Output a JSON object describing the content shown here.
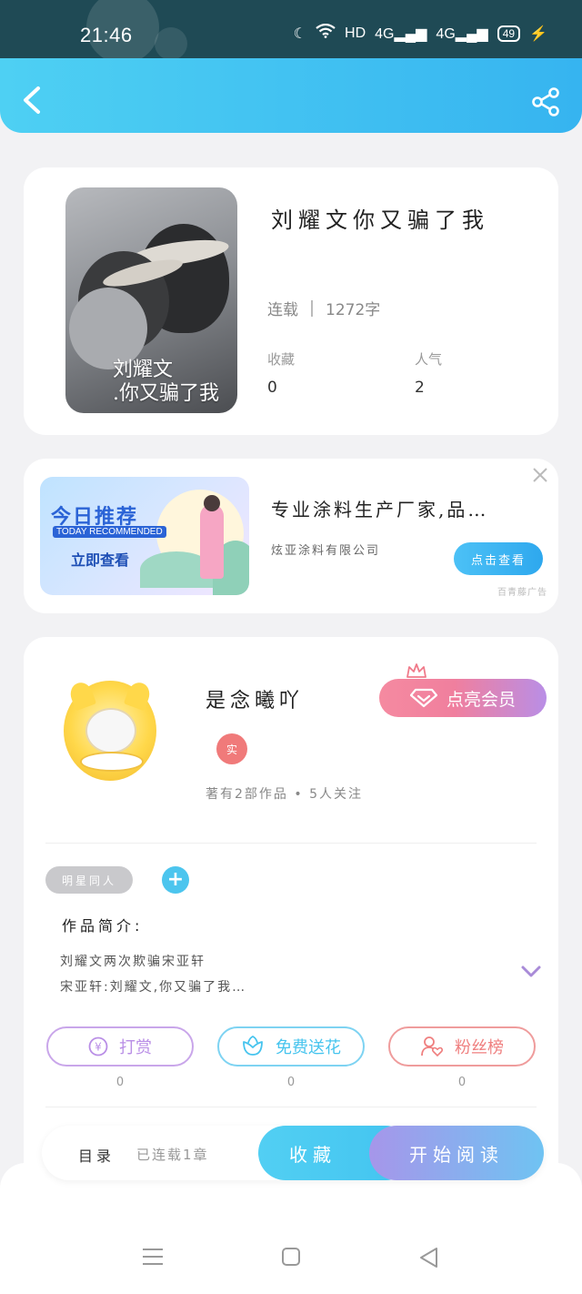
{
  "status_bar": {
    "time": "21:46",
    "network_label": "HD",
    "signal1": "4G",
    "signal2": "4G",
    "battery": "49"
  },
  "header": {
    "back_icon": "back-arrow-icon",
    "share_icon": "share-icon",
    "color": "#3fc2f2"
  },
  "book": {
    "cover_title_line1": "刘耀文",
    "cover_title_line2": ".你又骗了我",
    "title": "刘耀文你又骗了我",
    "status": "连载",
    "chapter_count": "1272字",
    "favorites_label": "收藏",
    "favorites_value": "0",
    "popularity_label": "人气",
    "popularity_value": "2"
  },
  "ad": {
    "banner_line1": "今日推荐",
    "banner_line2": "TODAY RECOMMENDED",
    "banner_line3": "立即查看",
    "title": "专业涂料生产厂家,品…",
    "company": "炫亚涂料有限公司",
    "button": "点击查看",
    "tag": "百青藤广告"
  },
  "author": {
    "name": "是念曦吖",
    "vip_button": "点亮会员",
    "real_badge": "实",
    "stats": "著有2部作品 • 5人关注",
    "tag": "明星同人",
    "intro_label": "作品简介:",
    "intro_line1": "刘耀文两次欺骗宋亚轩",
    "intro_line2": "宋亚轩:刘耀文,你又骗了我…",
    "actions": [
      {
        "label": "打赏",
        "count": "0",
        "color": "#b98ee6"
      },
      {
        "label": "免费送花",
        "count": "0",
        "color": "#46c4ee"
      },
      {
        "label": "粉丝榜",
        "count": "0",
        "color": "#f07a7a"
      }
    ]
  },
  "bottom_bar": {
    "toc": "目录",
    "serial": "已连载1章",
    "collect": "收藏",
    "read": "开始阅读"
  }
}
